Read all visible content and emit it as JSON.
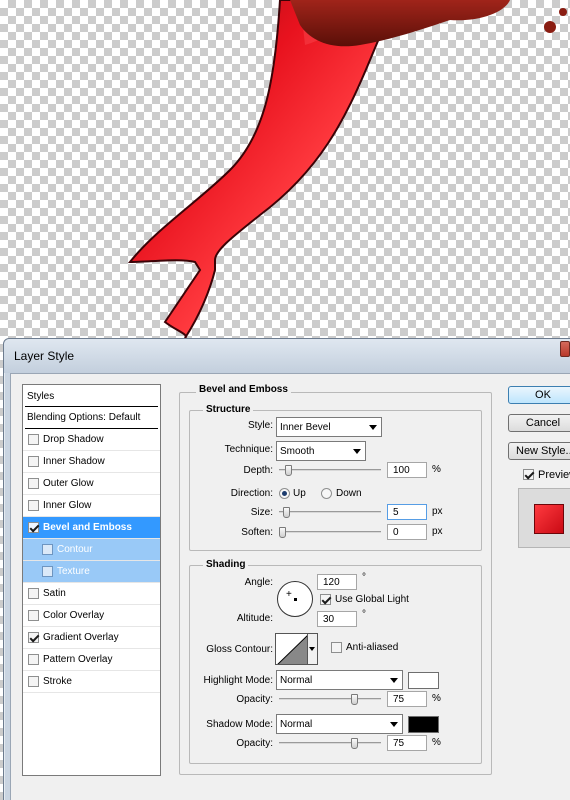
{
  "dialog": {
    "title": "Layer Style"
  },
  "styles_panel": {
    "header": "Styles",
    "blending_options": "Blending Options: Default",
    "items": [
      {
        "label": "Drop Shadow",
        "checked": false
      },
      {
        "label": "Inner Shadow",
        "checked": false
      },
      {
        "label": "Outer Glow",
        "checked": false
      },
      {
        "label": "Inner Glow",
        "checked": false
      },
      {
        "label": "Bevel and Emboss",
        "checked": true,
        "selected": true
      },
      {
        "label": "Contour",
        "checked": false,
        "sub": true
      },
      {
        "label": "Texture",
        "checked": false,
        "sub": true
      },
      {
        "label": "Satin",
        "checked": false
      },
      {
        "label": "Color Overlay",
        "checked": false
      },
      {
        "label": "Gradient Overlay",
        "checked": true
      },
      {
        "label": "Pattern Overlay",
        "checked": false
      },
      {
        "label": "Stroke",
        "checked": false
      }
    ]
  },
  "bevel": {
    "title": "Bevel and Emboss",
    "structure": {
      "title": "Structure",
      "style_label": "Style:",
      "style_value": "Inner Bevel",
      "technique_label": "Technique:",
      "technique_value": "Smooth",
      "depth_label": "Depth:",
      "depth_value": "100",
      "depth_unit": "%",
      "direction_label": "Direction:",
      "direction_up": "Up",
      "direction_down": "Down",
      "size_label": "Size:",
      "size_value": "5",
      "size_unit": "px",
      "soften_label": "Soften:",
      "soften_value": "0",
      "soften_unit": "px"
    },
    "shading": {
      "title": "Shading",
      "angle_label": "Angle:",
      "angle_value": "120",
      "angle_unit": "°",
      "global_light": "Use Global Light",
      "altitude_label": "Altitude:",
      "altitude_value": "30",
      "altitude_unit": "°",
      "gloss_label": "Gloss Contour:",
      "anti_aliased": "Anti-aliased",
      "highlight_label": "Highlight Mode:",
      "highlight_value": "Normal",
      "highlight_color": "#ffffff",
      "highlight_opacity_label": "Opacity:",
      "highlight_opacity_value": "75",
      "highlight_opacity_unit": "%",
      "shadow_label": "Shadow Mode:",
      "shadow_value": "Normal",
      "shadow_color": "#000000",
      "shadow_opacity_label": "Opacity:",
      "shadow_opacity_value": "75",
      "shadow_opacity_unit": "%"
    }
  },
  "buttons": {
    "ok": "OK",
    "cancel": "Cancel",
    "new_style": "New Style...",
    "preview": "Preview"
  },
  "colors": {
    "ribbon": "#e8121e",
    "selection": "#3399ff"
  }
}
